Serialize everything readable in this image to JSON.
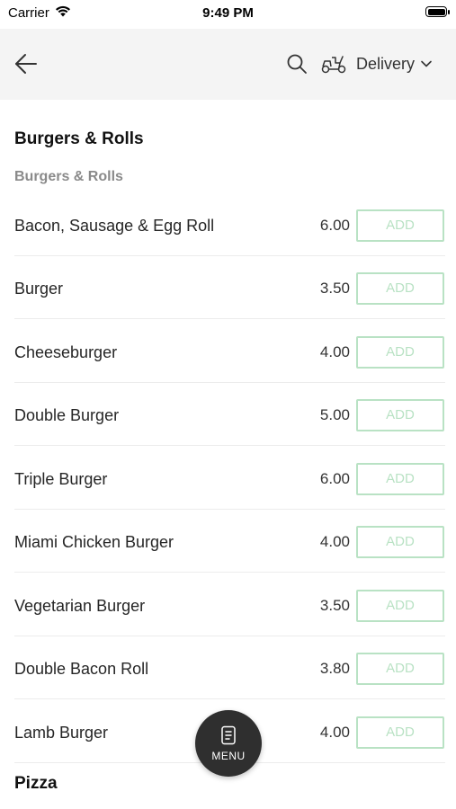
{
  "status_bar": {
    "carrier": "Carrier",
    "time": "9:49 PM"
  },
  "header": {
    "delivery_label": "Delivery"
  },
  "section": {
    "title": "Burgers & Rolls",
    "subtitle": "Burgers & Rolls",
    "add_label": "ADD",
    "items": [
      {
        "name": "Bacon, Sausage & Egg Roll",
        "price": "6.00"
      },
      {
        "name": "Burger",
        "price": "3.50"
      },
      {
        "name": "Cheeseburger",
        "price": "4.00"
      },
      {
        "name": "Double Burger",
        "price": "5.00"
      },
      {
        "name": "Triple Burger",
        "price": "6.00"
      },
      {
        "name": "Miami Chicken Burger",
        "price": "4.00"
      },
      {
        "name": "Vegetarian Burger",
        "price": "3.50"
      },
      {
        "name": "Double Bacon Roll",
        "price": "3.80"
      },
      {
        "name": "Lamb Burger",
        "price": "4.00"
      }
    ]
  },
  "next_section": {
    "title": "Pizza"
  },
  "fab": {
    "label": "MENU"
  },
  "colors": {
    "add_border": "#b9e2c4",
    "fab_bg": "#2f2f2f",
    "header_bg": "#f4f4f4"
  },
  "icons": [
    "wifi-icon",
    "battery-icon",
    "back-arrow-icon",
    "search-icon",
    "scooter-icon",
    "chevron-down-icon",
    "menu-icon"
  ]
}
